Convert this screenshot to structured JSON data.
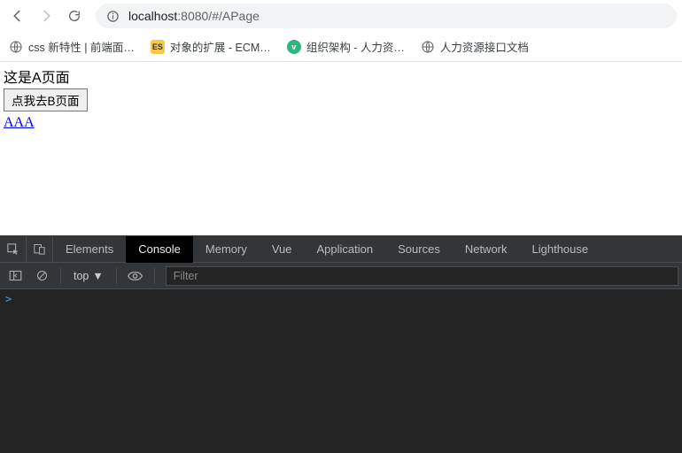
{
  "browser": {
    "url": {
      "host": "localhost",
      "rest": ":8080/#/APage"
    },
    "bookmarks": [
      {
        "icon": "globe",
        "label": "css 新特性 | 前端面…"
      },
      {
        "icon": "es",
        "label": "对象的扩展 - ECM…",
        "badge": "ES"
      },
      {
        "icon": "v",
        "label": "组织架构 - 人力资…",
        "badge": "v"
      },
      {
        "icon": "globe",
        "label": "人力资源接口文档"
      }
    ]
  },
  "page": {
    "title": "这是A页面",
    "button_label": "点我去B页面",
    "link_text": "AAA"
  },
  "devtools": {
    "tabs": [
      "Elements",
      "Console",
      "Memory",
      "Vue",
      "Application",
      "Sources",
      "Network",
      "Lighthouse"
    ],
    "active_tab": "Console",
    "context_label": "top",
    "filter_placeholder": "Filter",
    "prompt": ">"
  }
}
